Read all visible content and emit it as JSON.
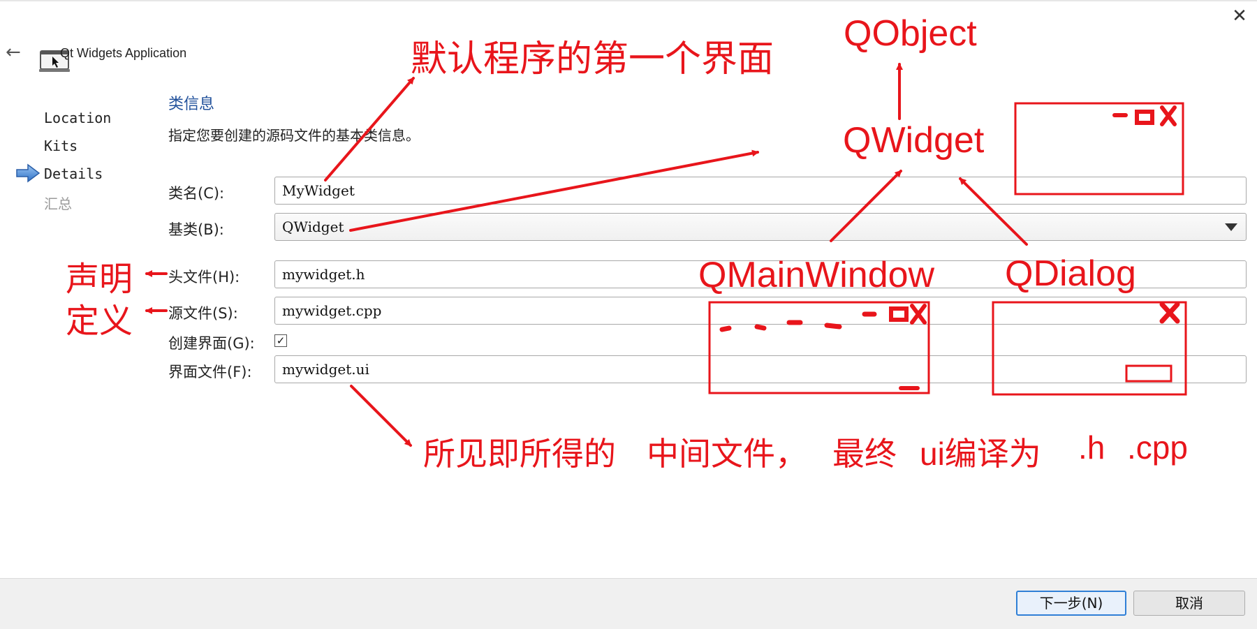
{
  "window": {
    "title": "Qt Widgets Application"
  },
  "sidebar": {
    "items": [
      {
        "label": "Location",
        "state": "done"
      },
      {
        "label": "Kits",
        "state": "done"
      },
      {
        "label": "Details",
        "state": "current"
      },
      {
        "label": "汇总",
        "state": "pending"
      }
    ]
  },
  "section": {
    "title": "类信息",
    "description": "指定您要创建的源码文件的基本类信息。"
  },
  "form": {
    "class_name": {
      "label": "类名(C):",
      "value": "MyWidget"
    },
    "base_class": {
      "label": "基类(B):",
      "value": "QWidget"
    },
    "header_file": {
      "label": "头文件(H):",
      "value": "mywidget.h"
    },
    "source_file": {
      "label": "源文件(S):",
      "value": "mywidget.cpp"
    },
    "create_ui": {
      "label": "创建界面(G):",
      "checked": true,
      "mark": "✓"
    },
    "ui_file": {
      "label": "界面文件(F):",
      "value": "mywidget.ui"
    }
  },
  "footer": {
    "next_label": "下一步(N)",
    "cancel_label": "取消"
  },
  "annotations": {
    "default_first_ui": "默认程序的第一个界面",
    "qobject": "QObject",
    "qwidget": "QWidget",
    "qmainwindow": "QMainWindow",
    "qdialog": "QDialog",
    "declare": "声明",
    "define": "定义",
    "wysiwyg": "所见即所得的",
    "intermediate_file": "中间文件，",
    "finally": "最终",
    "ui_compile": "ui编译为",
    "dot_h": ".h",
    "dot_cpp": ".cpp",
    "color": "#e8151b"
  },
  "icons": {
    "back": "back-arrow-icon",
    "close": "close-icon",
    "app": "window-cursor-icon",
    "current_step": "blue-arrow-icon",
    "combo": "chevron-down-icon"
  }
}
